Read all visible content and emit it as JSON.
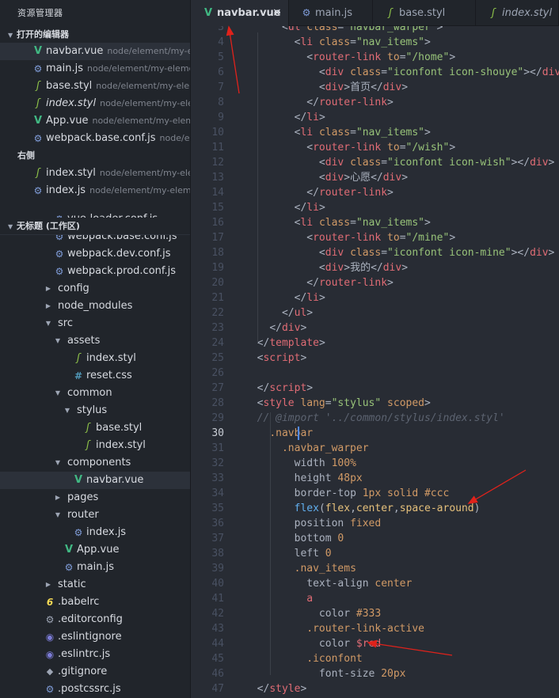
{
  "sidebar": {
    "title": "资源管理器",
    "open_editors": {
      "header": "打开的编辑器",
      "items": [
        {
          "name": "navbar.vue",
          "path": "node/element/my-e...",
          "icon": "vue-icon",
          "active": true
        },
        {
          "name": "main.js",
          "path": "node/element/my-eleme...",
          "icon": "js-icon"
        },
        {
          "name": "base.styl",
          "path": "node/element/my-ele...",
          "icon": "stylus-icon"
        },
        {
          "name": "index.styl",
          "path": "node/element/my-ele...",
          "icon": "stylus-icon",
          "italic": true
        },
        {
          "name": "App.vue",
          "path": "node/element/my-element...",
          "icon": "vue-icon"
        },
        {
          "name": "webpack.base.conf.js",
          "path": "node/ele...",
          "icon": "js-icon"
        }
      ],
      "right_group_label": "右侧",
      "right_items": [
        {
          "name": "index.styl",
          "path": "node/element/my-ele...",
          "icon": "stylus-icon"
        },
        {
          "name": "index.js",
          "path": "node/element/my-elem...",
          "icon": "js-icon"
        }
      ]
    },
    "workspace": {
      "header": "无标题 (工作区)",
      "tree": [
        {
          "label": "vue-loader.conf.js",
          "depth": 4,
          "icon": "js-icon",
          "type": "file"
        },
        {
          "label": "webpack.base.conf.js",
          "depth": 4,
          "icon": "js-icon",
          "type": "file"
        },
        {
          "label": "webpack.dev.conf.js",
          "depth": 4,
          "icon": "js-icon",
          "type": "file"
        },
        {
          "label": "webpack.prod.conf.js",
          "depth": 4,
          "icon": "js-icon",
          "type": "file"
        },
        {
          "label": "config",
          "depth": 3,
          "type": "folder",
          "expanded": false
        },
        {
          "label": "node_modules",
          "depth": 3,
          "type": "folder",
          "expanded": false
        },
        {
          "label": "src",
          "depth": 3,
          "type": "folder",
          "expanded": true
        },
        {
          "label": "assets",
          "depth": 4,
          "type": "folder",
          "expanded": true
        },
        {
          "label": "index.styl",
          "depth": 6,
          "icon": "stylus-icon",
          "type": "file"
        },
        {
          "label": "reset.css",
          "depth": 6,
          "icon": "css-icon",
          "type": "file"
        },
        {
          "label": "common",
          "depth": 4,
          "type": "folder",
          "expanded": true
        },
        {
          "label": "stylus",
          "depth": 5,
          "type": "folder",
          "expanded": true
        },
        {
          "label": "base.styl",
          "depth": 7,
          "icon": "stylus-icon",
          "type": "file"
        },
        {
          "label": "index.styl",
          "depth": 7,
          "icon": "stylus-icon",
          "type": "file"
        },
        {
          "label": "components",
          "depth": 4,
          "type": "folder",
          "expanded": true
        },
        {
          "label": "navbar.vue",
          "depth": 6,
          "icon": "vue-icon",
          "type": "file",
          "active": true
        },
        {
          "label": "pages",
          "depth": 4,
          "type": "folder",
          "expanded": false
        },
        {
          "label": "router",
          "depth": 4,
          "type": "folder",
          "expanded": true
        },
        {
          "label": "index.js",
          "depth": 6,
          "icon": "js-icon",
          "type": "file"
        },
        {
          "label": "App.vue",
          "depth": 5,
          "icon": "vue-icon",
          "type": "file"
        },
        {
          "label": "main.js",
          "depth": 5,
          "icon": "js-icon",
          "type": "file"
        },
        {
          "label": "static",
          "depth": 3,
          "type": "folder",
          "expanded": false
        },
        {
          "label": ".babelrc",
          "depth": 3,
          "icon": "babel-icon",
          "type": "file"
        },
        {
          "label": ".editorconfig",
          "depth": 3,
          "icon": "gear-icon",
          "type": "file"
        },
        {
          "label": ".eslintignore",
          "depth": 3,
          "icon": "eslint-icon",
          "type": "file"
        },
        {
          "label": ".eslintrc.js",
          "depth": 3,
          "icon": "eslint-icon",
          "type": "file"
        },
        {
          "label": ".gitignore",
          "depth": 3,
          "icon": "git-icon",
          "type": "file"
        },
        {
          "label": ".postcssrc.js",
          "depth": 3,
          "icon": "js-icon",
          "type": "file"
        }
      ]
    }
  },
  "tabs": [
    {
      "label": "navbar.vue",
      "icon": "vue-icon",
      "active": true,
      "close": "×"
    },
    {
      "label": "main.js",
      "icon": "js-icon"
    },
    {
      "label": "base.styl",
      "icon": "stylus-icon"
    },
    {
      "label": "index.styl",
      "icon": "stylus-icon",
      "italic": true
    }
  ],
  "editor": {
    "first_line": 4,
    "current_line": 30,
    "lines": [
      [
        [
          "      ",
          "t-pun"
        ],
        [
          "<",
          "t-pun"
        ],
        [
          "ul ",
          "t-tag"
        ],
        [
          "class",
          "t-attr"
        ],
        [
          "=",
          "t-pun"
        ],
        [
          "\"navbar_warper\"",
          "t-str"
        ],
        [
          ">",
          "t-pun"
        ]
      ],
      [
        [
          "        ",
          "t-pun"
        ],
        [
          "<",
          "t-pun"
        ],
        [
          "li ",
          "t-tag"
        ],
        [
          "class",
          "t-attr"
        ],
        [
          "=",
          "t-pun"
        ],
        [
          "\"nav_items\"",
          "t-str"
        ],
        [
          ">",
          "t-pun"
        ]
      ],
      [
        [
          "          ",
          "t-pun"
        ],
        [
          "<",
          "t-pun"
        ],
        [
          "router-link ",
          "t-tag"
        ],
        [
          "to",
          "t-attr"
        ],
        [
          "=",
          "t-pun"
        ],
        [
          "\"/home\"",
          "t-str"
        ],
        [
          ">",
          "t-pun"
        ]
      ],
      [
        [
          "            ",
          "t-pun"
        ],
        [
          "<",
          "t-pun"
        ],
        [
          "div ",
          "t-tag"
        ],
        [
          "class",
          "t-attr"
        ],
        [
          "=",
          "t-pun"
        ],
        [
          "\"iconfont icon-shouye\"",
          "t-str"
        ],
        [
          "></",
          "t-pun"
        ],
        [
          "div",
          "t-tag"
        ],
        [
          ">",
          "t-pun"
        ]
      ],
      [
        [
          "            ",
          "t-pun"
        ],
        [
          "<",
          "t-pun"
        ],
        [
          "div",
          "t-tag"
        ],
        [
          ">",
          "t-pun"
        ],
        [
          "首页",
          "t-txt"
        ],
        [
          "</",
          "t-pun"
        ],
        [
          "div",
          "t-tag"
        ],
        [
          ">",
          "t-pun"
        ]
      ],
      [
        [
          "          ",
          "t-pun"
        ],
        [
          "</",
          "t-pun"
        ],
        [
          "router-link",
          "t-tag"
        ],
        [
          ">",
          "t-pun"
        ]
      ],
      [
        [
          "        ",
          "t-pun"
        ],
        [
          "</",
          "t-pun"
        ],
        [
          "li",
          "t-tag"
        ],
        [
          ">",
          "t-pun"
        ]
      ],
      [
        [
          "        ",
          "t-pun"
        ],
        [
          "<",
          "t-pun"
        ],
        [
          "li ",
          "t-tag"
        ],
        [
          "class",
          "t-attr"
        ],
        [
          "=",
          "t-pun"
        ],
        [
          "\"nav_items\"",
          "t-str"
        ],
        [
          ">",
          "t-pun"
        ]
      ],
      [
        [
          "          ",
          "t-pun"
        ],
        [
          "<",
          "t-pun"
        ],
        [
          "router-link ",
          "t-tag"
        ],
        [
          "to",
          "t-attr"
        ],
        [
          "=",
          "t-pun"
        ],
        [
          "\"/wish\"",
          "t-str"
        ],
        [
          ">",
          "t-pun"
        ]
      ],
      [
        [
          "            ",
          "t-pun"
        ],
        [
          "<",
          "t-pun"
        ],
        [
          "div ",
          "t-tag"
        ],
        [
          "class",
          "t-attr"
        ],
        [
          "=",
          "t-pun"
        ],
        [
          "\"iconfont icon-wish\"",
          "t-str"
        ],
        [
          "></",
          "t-pun"
        ],
        [
          "div",
          "t-tag"
        ],
        [
          ">",
          "t-pun"
        ]
      ],
      [
        [
          "            ",
          "t-pun"
        ],
        [
          "<",
          "t-pun"
        ],
        [
          "div",
          "t-tag"
        ],
        [
          ">",
          "t-pun"
        ],
        [
          "心愿",
          "t-txt"
        ],
        [
          "</",
          "t-pun"
        ],
        [
          "div",
          "t-tag"
        ],
        [
          ">",
          "t-pun"
        ]
      ],
      [
        [
          "          ",
          "t-pun"
        ],
        [
          "</",
          "t-pun"
        ],
        [
          "router-link",
          "t-tag"
        ],
        [
          ">",
          "t-pun"
        ]
      ],
      [
        [
          "        ",
          "t-pun"
        ],
        [
          "</",
          "t-pun"
        ],
        [
          "li",
          "t-tag"
        ],
        [
          ">",
          "t-pun"
        ]
      ],
      [
        [
          "        ",
          "t-pun"
        ],
        [
          "<",
          "t-pun"
        ],
        [
          "li ",
          "t-tag"
        ],
        [
          "class",
          "t-attr"
        ],
        [
          "=",
          "t-pun"
        ],
        [
          "\"nav_items\"",
          "t-str"
        ],
        [
          ">",
          "t-pun"
        ]
      ],
      [
        [
          "          ",
          "t-pun"
        ],
        [
          "<",
          "t-pun"
        ],
        [
          "router-link ",
          "t-tag"
        ],
        [
          "to",
          "t-attr"
        ],
        [
          "=",
          "t-pun"
        ],
        [
          "\"/mine\"",
          "t-str"
        ],
        [
          ">",
          "t-pun"
        ]
      ],
      [
        [
          "            ",
          "t-pun"
        ],
        [
          "<",
          "t-pun"
        ],
        [
          "div ",
          "t-tag"
        ],
        [
          "class",
          "t-attr"
        ],
        [
          "=",
          "t-pun"
        ],
        [
          "\"iconfont icon-mine\"",
          "t-str"
        ],
        [
          "></",
          "t-pun"
        ],
        [
          "div",
          "t-tag"
        ],
        [
          ">",
          "t-pun"
        ]
      ],
      [
        [
          "            ",
          "t-pun"
        ],
        [
          "<",
          "t-pun"
        ],
        [
          "div",
          "t-tag"
        ],
        [
          ">",
          "t-pun"
        ],
        [
          "我的",
          "t-txt"
        ],
        [
          "</",
          "t-pun"
        ],
        [
          "div",
          "t-tag"
        ],
        [
          ">",
          "t-pun"
        ]
      ],
      [
        [
          "          ",
          "t-pun"
        ],
        [
          "</",
          "t-pun"
        ],
        [
          "router-link",
          "t-tag"
        ],
        [
          ">",
          "t-pun"
        ]
      ],
      [
        [
          "        ",
          "t-pun"
        ],
        [
          "</",
          "t-pun"
        ],
        [
          "li",
          "t-tag"
        ],
        [
          ">",
          "t-pun"
        ]
      ],
      [
        [
          "      ",
          "t-pun"
        ],
        [
          "</",
          "t-pun"
        ],
        [
          "ul",
          "t-tag"
        ],
        [
          ">",
          "t-pun"
        ]
      ],
      [
        [
          "    ",
          "t-pun"
        ],
        [
          "</",
          "t-pun"
        ],
        [
          "div",
          "t-tag"
        ],
        [
          ">",
          "t-pun"
        ]
      ],
      [
        [
          "  ",
          "t-pun"
        ],
        [
          "</",
          "t-pun"
        ],
        [
          "template",
          "t-tag"
        ],
        [
          ">",
          "t-pun"
        ]
      ],
      [
        [
          "  ",
          "t-pun"
        ],
        [
          "<",
          "t-pun"
        ],
        [
          "script",
          "t-tag"
        ],
        [
          ">",
          "t-pun"
        ]
      ],
      [
        [
          "",
          "t-pun"
        ]
      ],
      [
        [
          "  ",
          "t-pun"
        ],
        [
          "</",
          "t-pun"
        ],
        [
          "script",
          "t-tag"
        ],
        [
          ">",
          "t-pun"
        ]
      ],
      [
        [
          "  ",
          "t-pun"
        ],
        [
          "<",
          "t-pun"
        ],
        [
          "style ",
          "t-tag"
        ],
        [
          "lang",
          "t-attr"
        ],
        [
          "=",
          "t-pun"
        ],
        [
          "\"stylus\"",
          "t-str"
        ],
        [
          " ",
          "t-pun"
        ],
        [
          "scoped",
          "t-attr"
        ],
        [
          ">",
          "t-pun"
        ]
      ],
      [
        [
          "  ",
          "t-pun"
        ],
        [
          "// @import '../common/stylus/index.styl'",
          "t-cmt"
        ]
      ],
      [
        [
          "    ",
          "t-pun"
        ],
        [
          ".navbar",
          "t-sel"
        ]
      ],
      [
        [
          "      ",
          "t-pun"
        ],
        [
          ".navbar_warper",
          "t-sel"
        ]
      ],
      [
        [
          "        ",
          "t-pun"
        ],
        [
          "width ",
          "t-prop"
        ],
        [
          "100%",
          "t-num"
        ]
      ],
      [
        [
          "        ",
          "t-pun"
        ],
        [
          "height ",
          "t-prop"
        ],
        [
          "48px",
          "t-num"
        ]
      ],
      [
        [
          "        ",
          "t-pun"
        ],
        [
          "border-top ",
          "t-prop"
        ],
        [
          "1px solid #ccc",
          "t-val"
        ]
      ],
      [
        [
          "        ",
          "t-pun"
        ],
        [
          "flex",
          "t-fn"
        ],
        [
          "(",
          "t-pun"
        ],
        [
          "flex",
          "t-kw"
        ],
        [
          ",",
          "t-pun"
        ],
        [
          "center",
          "t-kw"
        ],
        [
          ",",
          "t-pun"
        ],
        [
          "space-around",
          "t-kw"
        ],
        [
          ")",
          "t-pun"
        ]
      ],
      [
        [
          "        ",
          "t-pun"
        ],
        [
          "position ",
          "t-prop"
        ],
        [
          "fixed",
          "t-val"
        ]
      ],
      [
        [
          "        ",
          "t-pun"
        ],
        [
          "bottom ",
          "t-prop"
        ],
        [
          "0",
          "t-num"
        ]
      ],
      [
        [
          "        ",
          "t-pun"
        ],
        [
          "left ",
          "t-prop"
        ],
        [
          "0",
          "t-num"
        ]
      ],
      [
        [
          "        ",
          "t-pun"
        ],
        [
          ".nav_items",
          "t-sel"
        ]
      ],
      [
        [
          "          ",
          "t-pun"
        ],
        [
          "text-align ",
          "t-prop"
        ],
        [
          "center",
          "t-val"
        ]
      ],
      [
        [
          "          ",
          "t-pun"
        ],
        [
          "a",
          "t-tag"
        ]
      ],
      [
        [
          "            ",
          "t-pun"
        ],
        [
          "color ",
          "t-prop"
        ],
        [
          "#333",
          "t-val"
        ]
      ],
      [
        [
          "          ",
          "t-pun"
        ],
        [
          ".router-link-active",
          "t-sel"
        ]
      ],
      [
        [
          "            ",
          "t-pun"
        ],
        [
          "color ",
          "t-prop"
        ],
        [
          "$red",
          "t-var"
        ]
      ],
      [
        [
          "          ",
          "t-pun"
        ],
        [
          ".iconfont",
          "t-sel"
        ]
      ],
      [
        [
          "            ",
          "t-pun"
        ],
        [
          "font-size ",
          "t-prop"
        ],
        [
          "20px",
          "t-num"
        ]
      ],
      [
        [
          "  ",
          "t-pun"
        ],
        [
          "</",
          "t-pun"
        ],
        [
          "style",
          "t-tag"
        ],
        [
          ">",
          "t-pun"
        ]
      ],
      [
        [
          "",
          "t-pun"
        ]
      ]
    ]
  },
  "colors": {
    "annotation_arrow": "#e0221b",
    "accent": "#528bff"
  }
}
